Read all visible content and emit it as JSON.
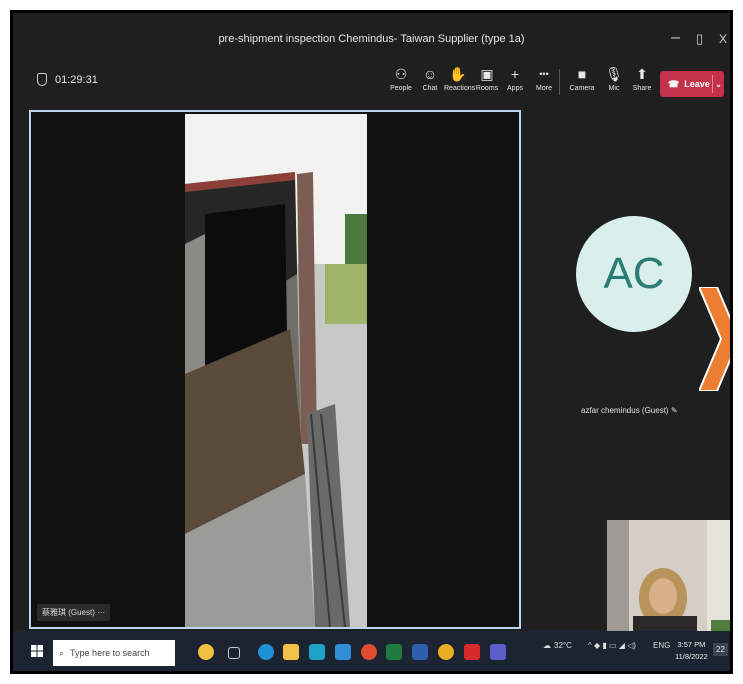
{
  "window": {
    "title": "pre-shipment inspection Chemindus- Taiwan Supplier (type 1a)",
    "controls": [
      "–",
      "▯",
      "X"
    ]
  },
  "toolbar": {
    "timer": "01:29:31",
    "items": [
      {
        "label": "People",
        "icon": "people-icon",
        "glyph": "⚇"
      },
      {
        "label": "Chat",
        "icon": "chat-icon",
        "glyph": "☺"
      },
      {
        "label": "Reactions",
        "icon": "reactions-icon",
        "glyph": "✋"
      },
      {
        "label": "Rooms",
        "icon": "rooms-icon",
        "glyph": "▣"
      },
      {
        "label": "Apps",
        "icon": "apps-icon",
        "glyph": "+"
      },
      {
        "label": "More",
        "icon": "more-icon",
        "glyph": "•••"
      },
      {
        "label": "Camera",
        "icon": "camera-icon",
        "glyph": "■"
      },
      {
        "label": "Mic",
        "icon": "mic-icon",
        "glyph": "🎙"
      },
      {
        "label": "Share",
        "icon": "share-icon",
        "glyph": "⬆"
      }
    ],
    "leave_label": "Leave",
    "leave_color": "#c4314b"
  },
  "stage": {
    "speaker_name": "蔡雅琪 (Guest) ···"
  },
  "participant": {
    "initials": "AC",
    "name": "azfar chemindus (Guest)  ✎",
    "avatar_bg": "#d8efec",
    "avatar_fg": "#2b7c74"
  },
  "taskbar": {
    "search_placeholder": "Type here to search",
    "weather": "32°C",
    "lang": "ENG",
    "time": "3:57 PM",
    "date": "11/8/2022",
    "notif_count": "22"
  },
  "overlay": {
    "arrow_color": "#ed7d31"
  }
}
